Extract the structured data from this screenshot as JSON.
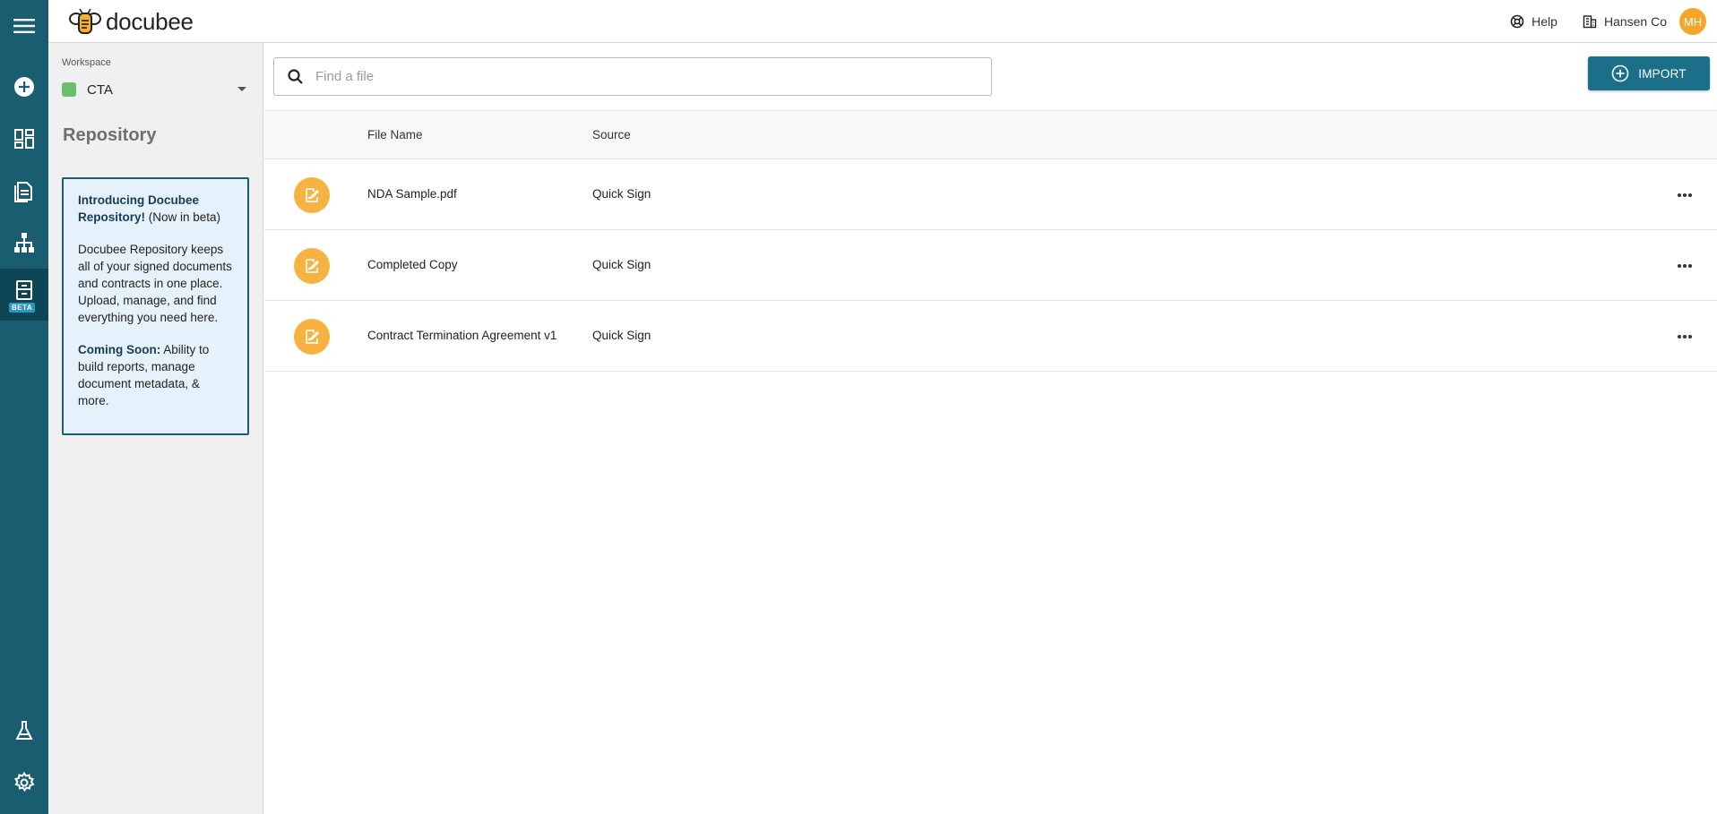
{
  "app": {
    "logo_text": "docubee"
  },
  "header": {
    "help_label": "Help",
    "org_label": "Hansen Co",
    "avatar_initials": "MH"
  },
  "sidebar": {
    "workspace_label": "Workspace",
    "workspace_name": "CTA",
    "workspace_color": "#6bbf72",
    "section_title": "Repository",
    "info": {
      "headline": "Introducing Docubee Repository!",
      "headline_suffix": " (Now in beta)",
      "body": "Docubee Repository keeps all of your signed documents and contracts in one place. Upload, manage, and find everything you need here.",
      "coming_label": "Coming Soon:",
      "coming_text": " Ability to build reports, manage document metadata, & more."
    }
  },
  "rail": {
    "beta_label": "BETA"
  },
  "search": {
    "placeholder": "Find a file",
    "value": ""
  },
  "toolbar": {
    "import_label": "IMPORT"
  },
  "table": {
    "columns": {
      "name": "File Name",
      "source": "Source"
    },
    "rows": [
      {
        "name": "NDA Sample.pdf",
        "source": "Quick Sign"
      },
      {
        "name": "Completed Copy",
        "source": "Quick Sign"
      },
      {
        "name": "Contract Termination Agreement v1",
        "source": "Quick Sign"
      }
    ]
  },
  "colors": {
    "rail": "#1b5d70",
    "accent": "#1b6f89",
    "file_icon": "#f7b342",
    "avatar": "#f4a62a"
  }
}
